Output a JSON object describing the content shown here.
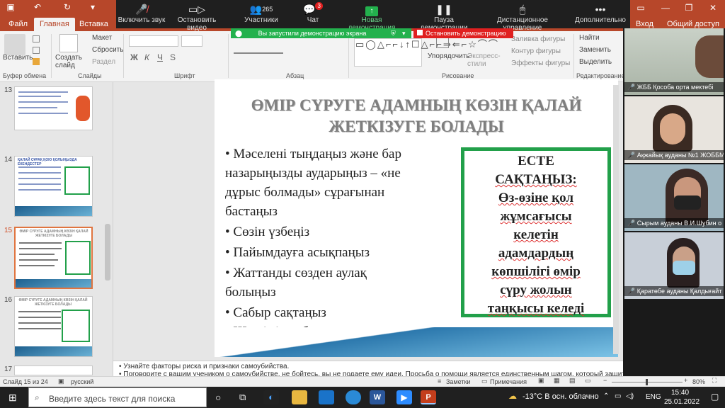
{
  "titlebar": {
    "tabs": [
      "Файл",
      "Главная",
      "Вставка"
    ],
    "active_tab": "Главная",
    "right_tabs": [
      "Вход",
      "Общий доступ"
    ]
  },
  "zoom": {
    "buttons": [
      {
        "label": "Включить звук",
        "icon": "mic-off-icon"
      },
      {
        "label": "Остановить видео",
        "icon": "video-icon"
      },
      {
        "label": "Участники",
        "icon": "participants-icon",
        "count": "265"
      },
      {
        "label": "Чат",
        "icon": "chat-icon",
        "badge": "3"
      },
      {
        "label": "Новая демонстрация",
        "icon": "share-icon"
      },
      {
        "label": "Пауза демонстрации",
        "icon": "pause-icon"
      },
      {
        "label": "Дистанционное управление",
        "icon": "mouse-icon"
      },
      {
        "label": "Дополнительно",
        "icon": "more-icon"
      }
    ],
    "share_notice": "Вы запустили демонстрацию экрана",
    "stop_share": "Остановить демонстрацию"
  },
  "ribbon": {
    "paste": "Вставить",
    "create_slide": "Создать слайд",
    "layout": "Макет",
    "reset": "Сбросить",
    "section": "Раздел",
    "groups": [
      "Буфер обмена",
      "Слайды",
      "Шрифт",
      "Абзац",
      "Рисование",
      "Редактирование"
    ],
    "arrange": "Упорядочить",
    "express": "Экспресс-стили",
    "fill": "Заливка фигуры",
    "outline": "Контур фигуры",
    "effects": "Эффекты фигуры",
    "find": "Найти",
    "replace": "Заменить",
    "select": "Выделить"
  },
  "thumbs": [
    {
      "num": "13",
      "title": ""
    },
    {
      "num": "14",
      "title": "ҚАЛАЙ СҰРАҚ ҚОЮ ҚОЛЫҢЫЗДА ЕКЕНДЕСТЕР"
    },
    {
      "num": "15",
      "title": "ӨМІР СҮРУГЕ АДАМНЫҢ КӨЗІН ҚАЛАЙ ЖЕТКІЗУГЕ БОЛАДЫ"
    },
    {
      "num": "16",
      "title": "ӨМІР СҮРУГЕ АДАМНЫҢ КӨЗІН ҚАЛАЙ ЖЕТКІЗУГЕ БОЛАДЫ"
    },
    {
      "num": "17",
      "title": ""
    }
  ],
  "slide": {
    "title_line1": "ӨМІР СҮРУГЕ АДАМНЫҢ КӨЗІН ҚАЛАЙ",
    "title_line2": "ЖЕТКІЗУГЕ БОЛАДЫ",
    "bullets": [
      "•  Мәселені тыңдаңыз және бар",
      "назарыңызды аударыңыз – «не",
      "дұрыс болмады» сұрағынан",
      "бастаңыз",
      "• Сөзін үзбеңіз",
      "• Пайымдауға асықпаңыз",
      "• Жаттанды сөзден аулақ",
      "болыңыз",
      "• Сабыр сақтаңыз",
      "• Шешімін табуға асықпаңыз"
    ],
    "note_lines": [
      "ЕСТЕ",
      "САҚТАҢЫЗ:",
      "Өз-өзіне қол",
      "жұмсағысы",
      "келетін",
      "адамдардың",
      "көпшілігі өмір",
      "сүру жолын",
      "таңқысы келеді"
    ]
  },
  "notes": {
    "line1": "• Узнайте факторы риска и признаки самоубийства.",
    "line2": "• Поговорите с вашим учеником о самоубийстве, не бойтесь, вы не подаете ему идеи. Просьба о помощи является единственным шагом, который защитит"
  },
  "status": {
    "slide": "Слайд 15 из 24",
    "lang": "русский",
    "notes": "Заметки",
    "comments": "Примечания",
    "zoom": "80%"
  },
  "taskbar": {
    "search": "Введите здесь текст для поиска",
    "weather": "-13°C  В осн. облачно",
    "lang": "ENG",
    "time": "15:40",
    "date": "25.01.2022"
  },
  "video": [
    {
      "name": "ЖББ Қособа орта мектебі"
    },
    {
      "name": "Ақжайық ауданы №1 ЖОББМ"
    },
    {
      "name": "Сырым ауданы В.И.Шубин о"
    },
    {
      "name": "Қаратөбе ауданы Қалдығайт"
    }
  ],
  "colors": {
    "accent": "#b7472a",
    "zoom_green": "#23b14d",
    "zoom_red": "#e02020",
    "note_border": "#22a04a"
  }
}
